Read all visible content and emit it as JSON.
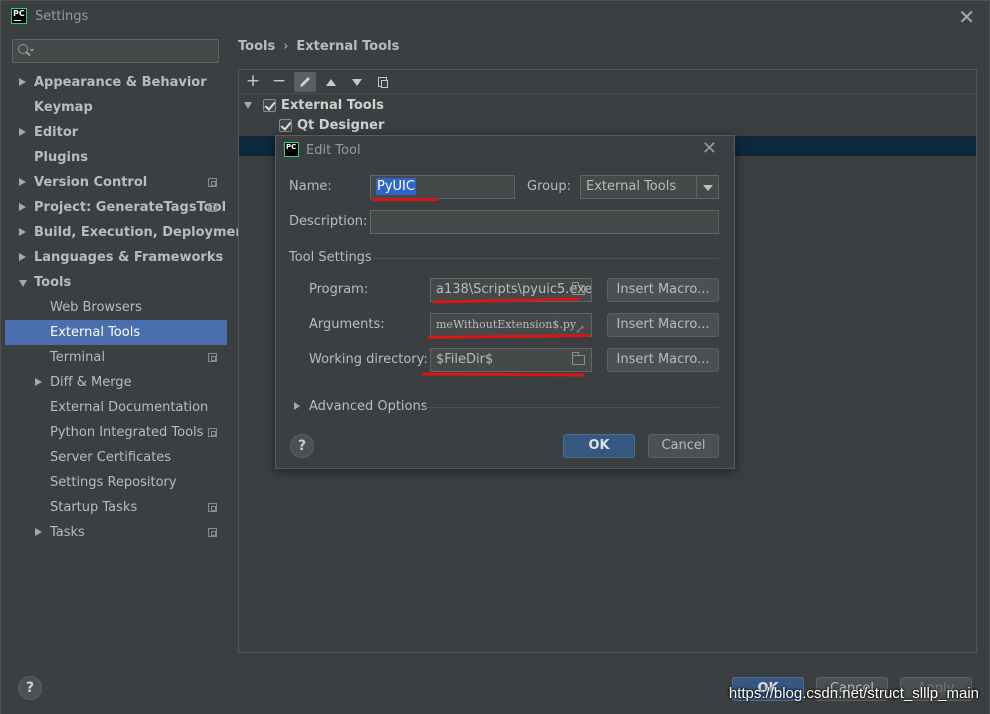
{
  "window": {
    "title": "Settings"
  },
  "search": {
    "placeholder": ""
  },
  "nav": {
    "appearance": "Appearance & Behavior",
    "keymap": "Keymap",
    "editor": "Editor",
    "plugins": "Plugins",
    "version_control": "Version Control",
    "project": "Project: GenerateTagsTool",
    "build": "Build, Execution, Deployment",
    "languages": "Languages & Frameworks",
    "tools": "Tools",
    "web_browsers": "Web Browsers",
    "external_tools": "External Tools",
    "terminal": "Terminal",
    "diff_merge": "Diff & Merge",
    "external_documentation": "External Documentation",
    "python_integrated_tools": "Python Integrated Tools",
    "server_certificates": "Server Certificates",
    "settings_repository": "Settings Repository",
    "startup_tasks": "Startup Tasks",
    "tasks": "Tasks"
  },
  "breadcrumb": {
    "parent": "Tools",
    "separator": "›",
    "current": "External Tools"
  },
  "toolbar": {
    "add": "+",
    "remove": "−"
  },
  "tree": {
    "group": "External Tools",
    "item": "Qt Designer"
  },
  "dialog": {
    "title": "Edit Tool",
    "name_label": "Name:",
    "name_value": "PyUIC",
    "group_label": "Group:",
    "group_value": "External Tools",
    "description_label": "Description:",
    "description_value": "",
    "tool_settings_label": "Tool Settings",
    "program_label": "Program:",
    "program_value": "а138\\Scripts\\pyuic5.exe",
    "arguments_label": "Arguments:",
    "arguments_value": "meWithoutExtension$.py",
    "working_dir_label": "Working directory:",
    "working_dir_value": "$FileDir$",
    "insert_macro": "Insert Macro...",
    "advanced_options": "Advanced Options",
    "help": "?",
    "ok": "OK",
    "cancel": "Cancel"
  },
  "footer": {
    "help": "?",
    "ok": "OK",
    "cancel": "Cancel",
    "apply": "Apply"
  },
  "watermark": "https://blog.csdn.net/struct_slllp_main",
  "colors": {
    "selection": "#4b6eaf",
    "primary_button": "#365880",
    "annotation_red": "#d91515"
  }
}
